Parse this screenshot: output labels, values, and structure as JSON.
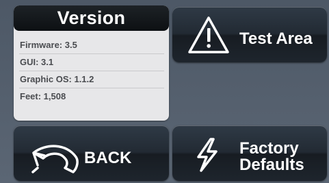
{
  "version_panel": {
    "title": "Version",
    "rows": [
      {
        "text": "Firmware: 3.5"
      },
      {
        "text": "GUI: 3.1"
      },
      {
        "text": "Graphic OS: 1.1.2"
      },
      {
        "text": "Feet: 1,508"
      }
    ]
  },
  "buttons": {
    "test_area": {
      "label": "Test Area",
      "icon": "warning-triangle-icon"
    },
    "back": {
      "label": "BACK",
      "icon": "undo-arrow-icon"
    },
    "factory_defaults": {
      "label_line1": "Factory",
      "label_line2": "Defaults",
      "icon": "lightning-bolt-icon"
    }
  },
  "colors": {
    "background": "#55606e",
    "panel": "#e7e7e9",
    "panel_header": "#0d1013",
    "button": "#222a33",
    "text_light": "#ffffff",
    "text_dark": "#4a4c50"
  }
}
